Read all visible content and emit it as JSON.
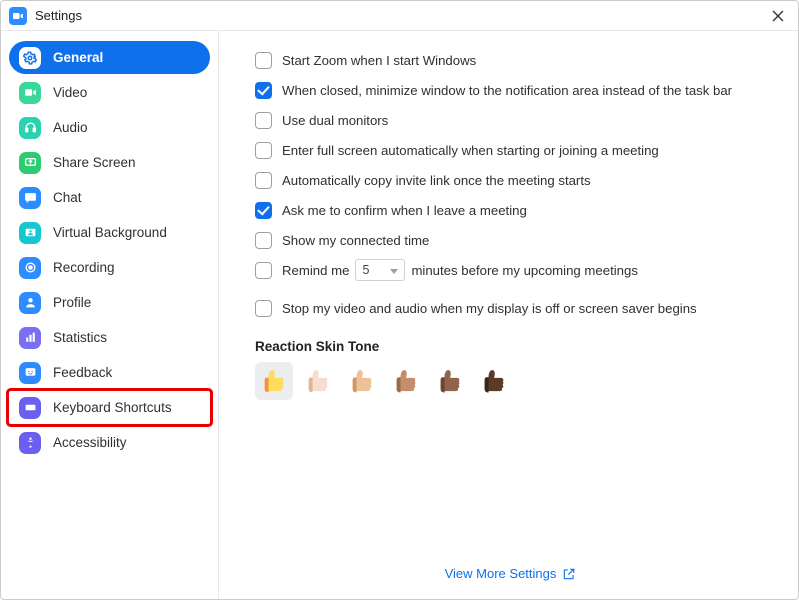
{
  "window": {
    "title": "Settings"
  },
  "sidebar": {
    "items": [
      {
        "label": "General"
      },
      {
        "label": "Video"
      },
      {
        "label": "Audio"
      },
      {
        "label": "Share Screen"
      },
      {
        "label": "Chat"
      },
      {
        "label": "Virtual Background"
      },
      {
        "label": "Recording"
      },
      {
        "label": "Profile"
      },
      {
        "label": "Statistics"
      },
      {
        "label": "Feedback"
      },
      {
        "label": "Keyboard Shortcuts"
      },
      {
        "label": "Accessibility"
      }
    ]
  },
  "options": {
    "start_with_windows": "Start Zoom when I start Windows",
    "minimize_tray": "When closed, minimize window to the notification area instead of the task bar",
    "dual_monitors": "Use dual monitors",
    "full_screen": "Enter full screen automatically when starting or joining a meeting",
    "copy_invite": "Automatically copy invite link once the meeting starts",
    "confirm_leave": "Ask me to confirm when I leave a meeting",
    "connected_time": "Show my connected time",
    "remind_pre": "Remind me",
    "remind_value": "5",
    "remind_post": "minutes before my upcoming meetings",
    "stop_av_screensaver": "Stop my video and audio when my display is off or screen saver begins"
  },
  "reactions": {
    "title": "Reaction Skin Tone"
  },
  "footer": {
    "more_settings": "View More Settings"
  }
}
